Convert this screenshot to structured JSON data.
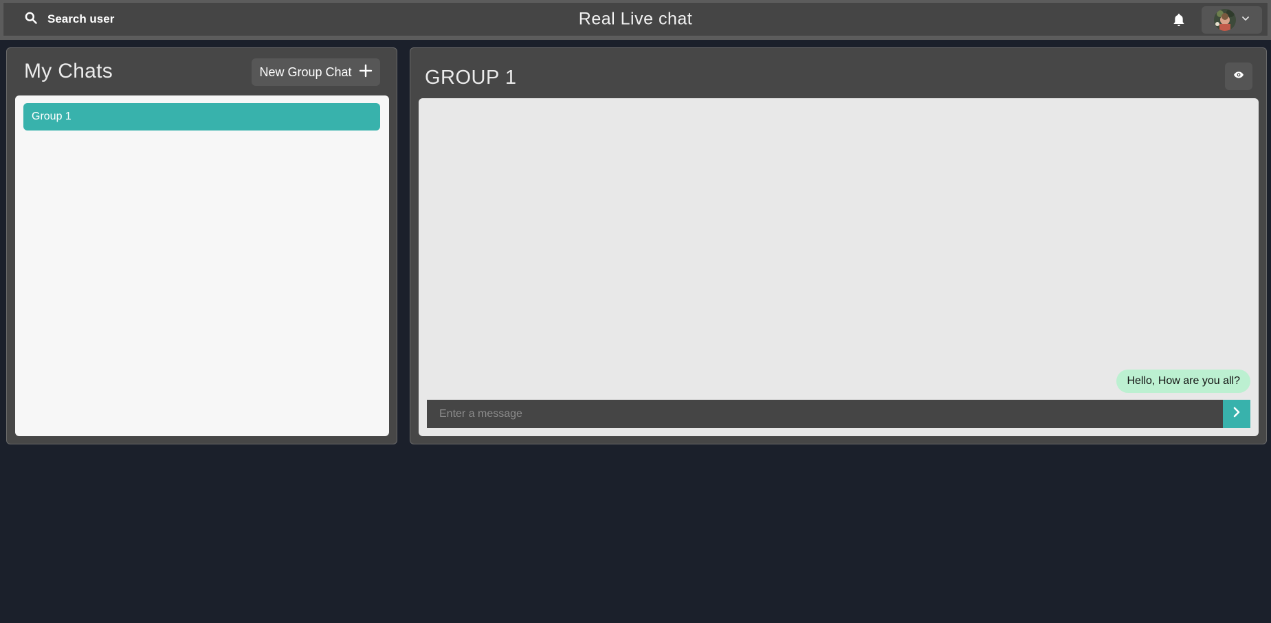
{
  "header": {
    "search_label": "Search user",
    "app_title": "Real Live chat",
    "search_icon": "search-icon",
    "bell_icon": "bell-icon",
    "chevron_icon": "chevron-down-icon"
  },
  "sidebar": {
    "title": "My Chats",
    "new_group_label": "New Group Chat",
    "new_group_icon": "plus-icon",
    "chats": [
      {
        "name": "Group 1",
        "selected": true
      }
    ]
  },
  "chat": {
    "title": "GROUP 1",
    "view_icon": "eye-icon",
    "messages": [
      {
        "text": "Hello, How are you all?",
        "own": true
      }
    ],
    "input_placeholder": "Enter a message",
    "send_icon": "chevron-right-icon"
  },
  "colors": {
    "accent": "#38b2ac",
    "page_bg": "#1b202b",
    "panel_bg": "#474747",
    "own_message_bg": "#bcf0d1"
  }
}
